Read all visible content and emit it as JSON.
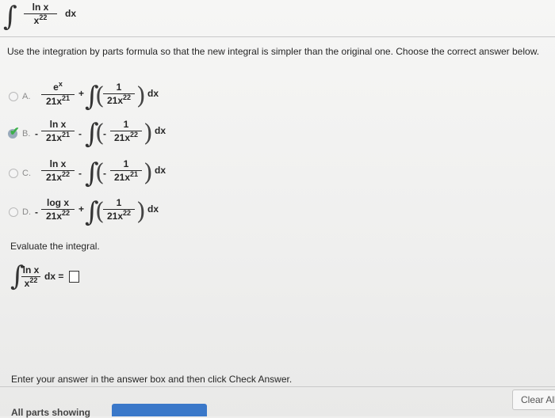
{
  "header": {
    "integrand_num": "ln x",
    "integrand_den": "x",
    "integrand_den_exp": "22",
    "dx": "dx"
  },
  "instructions": "Use the integration by parts formula so that the new integral is simpler than the original one. Choose the correct answer below.",
  "options": [
    {
      "letter": "A.",
      "selected": false,
      "lead_sign": "",
      "t1_num": "e",
      "t1_num_exp": "x",
      "t1_den": "21x",
      "t1_den_exp": "21",
      "op": "+",
      "inner_sign": "",
      "t2_num": "1",
      "t2_den": "21x",
      "t2_den_exp": "22",
      "dx": "dx"
    },
    {
      "letter": "B.",
      "selected": true,
      "lead_sign": "-",
      "t1_num": "ln x",
      "t1_num_exp": "",
      "t1_den": "21x",
      "t1_den_exp": "21",
      "op": "-",
      "inner_sign": "-",
      "t2_num": "1",
      "t2_den": "21x",
      "t2_den_exp": "22",
      "dx": "dx"
    },
    {
      "letter": "C.",
      "selected": false,
      "lead_sign": "",
      "t1_num": "ln x",
      "t1_num_exp": "",
      "t1_den": "21x",
      "t1_den_exp": "22",
      "op": "-",
      "inner_sign": "-",
      "t2_num": "1",
      "t2_den": "21x",
      "t2_den_exp": "21",
      "dx": "dx"
    },
    {
      "letter": "D.",
      "selected": false,
      "lead_sign": "-",
      "t1_num": "log x",
      "t1_num_exp": "",
      "t1_den": "21x",
      "t1_den_exp": "22",
      "op": "+",
      "inner_sign": "",
      "t2_num": "1",
      "t2_den": "21x",
      "t2_den_exp": "22",
      "dx": "dx"
    }
  ],
  "evaluate": {
    "label": "Evaluate the integral.",
    "integrand_num": "ln x",
    "integrand_den": "x",
    "integrand_den_exp": "22",
    "dx_eq": "dx ="
  },
  "footer": {
    "prompt": "Enter your answer in the answer box and then click Check Answer.",
    "parts_label": "All parts showing",
    "clear_all": "Clear All"
  },
  "colors": {
    "selected_check": "#3cb04a",
    "progress": "#3a78c9"
  }
}
